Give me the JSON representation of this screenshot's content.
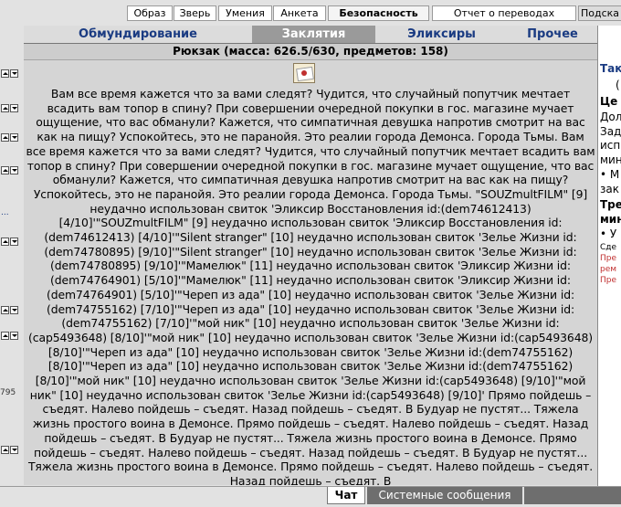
{
  "top_nav": {
    "items": [
      "Образ",
      "Зверь",
      "Умения",
      "Анкета",
      "Безопасность",
      "Отчет о переводах",
      "Подска"
    ],
    "active": "Безопасность"
  },
  "categories": {
    "tabs": [
      "Обмундирование",
      "Заклятия",
      "Эликсиры",
      "Прочее"
    ],
    "active": "Заклятия"
  },
  "backpack": {
    "header": "Рюкзак (масса: 626.5/630, предметов: 158)"
  },
  "item": {
    "icon": "scroll-icon",
    "description": "Вам все время кажется что за вами следят? Чудится, что случайный попутчик мечтает всадить вам топор в спину? При совершении очередной покупки в гос. магазине мучает ощущение, что вас обманули? Кажется, что симпатичная девушка напротив смотрит на вас как на пищу? Успокойтесь, это не паранойя. Это реалии города Демонса. Города Тьмы. Вам все время кажется что за вами следят? Чудится, что случайный попутчик мечтает всадить вам топор в спину? При совершении очередной покупки в гос. магазине мучает ощущение, что вас обманули? Кажется, что симпатичная девушка напротив смотрит на вас как на пищу? Успокойтесь, это не паранойя. Это реалии города Демонса. Города Тьмы. \"SOUZmultFILM\" [9] неудачно использован свиток 'Эликсир Восстановления id:(dem74612413) [4/10]'\"SOUZmultFILM\" [9] неудачно использован свиток 'Эликсир Восстановления id:(dem74612413) [4/10]'\"Silent stranger\" [10] неудачно использован свиток 'Зелье Жизни id:(dem74780895) [9/10]'\"Silent stranger\" [10] неудачно использован свиток 'Зелье Жизни id:(dem74780895) [9/10]'\"Мамелюк\" [11] неудачно использован свиток 'Эликсир Жизни id:(dem74764901) [5/10]'\"Мамелюк\" [11] неудачно использован свиток 'Эликсир Жизни id:(dem74764901) [5/10]'\"Череп из ада\" [10] неудачно использован свиток 'Зелье Жизни id:(dem74755162) [7/10]'\"Череп из ада\" [10] неудачно использован свиток 'Зелье Жизни id:(dem74755162) [7/10]'\"мой ник\" [10] неудачно использован свиток 'Зелье Жизни id:(cap5493648) [8/10]'\"мой ник\" [10] неудачно использован свиток 'Зелье Жизни id:(cap5493648) [8/10]'\"Череп из ада\" [10] неудачно использован свиток 'Зелье Жизни id:(dem74755162) [8/10]'\"Череп из ада\" [10] неудачно использован свиток 'Зелье Жизни id:(dem74755162) [8/10]'\"мой ник\" [10] неудачно использован свиток 'Зелье Жизни id:(cap5493648) [9/10]'\"мой ник\" [10] неудачно использован свиток 'Зелье Жизни id:(cap5493648) [9/10]' Прямо пойдешь – съедят. Налево пойдешь – съедят. Назад пойдешь – съедят. В Будуар не пустят... Тяжела жизнь простого воина в Демонсе. Прямо пойдешь – съедят. Налево пойдешь – съедят. Назад пойдешь – съедят. В Будуар не пустят... Тяжела жизнь простого воина в Демонсе. Прямо пойдешь – съедят. Налево пойдешь – съедят. Назад пойдешь – съедят. В Будуар не пустят... Тяжела жизнь простого воина в Демонсе. Прямо пойдешь – съедят. Налево пойдешь – съедят. Назад пойдешь – съедят. В"
  },
  "left_gutter": {
    "fragments": [
      "...",
      "795"
    ]
  },
  "right_panel": {
    "lines": [
      "Так",
      "(",
      "Це",
      "Дол",
      "Зад",
      "исп",
      "мин",
      "• М",
      "зак",
      "Тре",
      "мин",
      "• У",
      "Сде",
      "Пре",
      "рем",
      "Пре"
    ]
  },
  "bottom_tabs": {
    "items": [
      "Чат",
      "Системные сообщения"
    ],
    "active": "Чат"
  },
  "colors": {
    "tab_text": "#1a3b82",
    "active_tab_bg": "#9a9a9a",
    "system_tab_bg": "#6e6e6e",
    "panel_bg": "#d5d5d5",
    "right_red": "#c03030"
  }
}
